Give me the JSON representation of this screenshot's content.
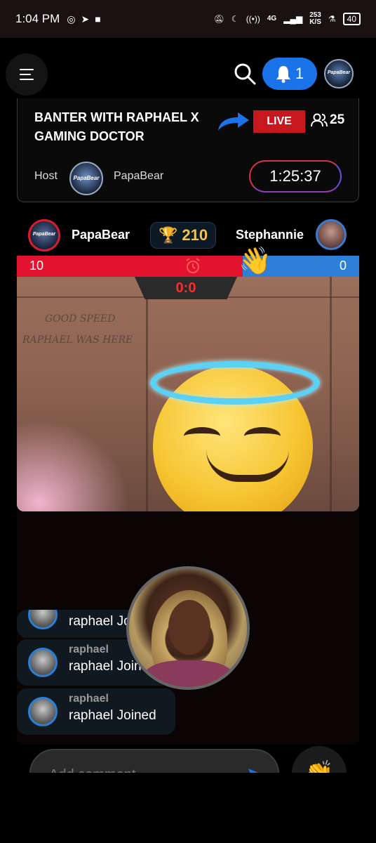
{
  "status_bar": {
    "time": "1:04 PM",
    "net_speed_value": "253",
    "net_speed_unit": "K/S",
    "network": "4G",
    "battery": "40"
  },
  "header": {
    "notification_count": "1",
    "avatar_text": "PapaBear"
  },
  "stream": {
    "title": "BANTER WITH RAPHAEL X GAMING DOCTOR",
    "live_label": "LIVE",
    "viewer_count": "25",
    "host_label": "Host",
    "host_avatar_text": "PapaBear",
    "host_name": "PapaBear",
    "timer": "1:25:37"
  },
  "battle": {
    "player1_name": "PapaBear",
    "player1_avatar_text": "PapaBear",
    "trophy_points": "210",
    "player2_name": "Stephannie",
    "player1_score": "10",
    "player2_score": "0",
    "player1_share": 0.66,
    "round_score": "0:0"
  },
  "video_scribbles": [
    "GOOD SPEED",
    "RAPHAEL WAS HERE"
  ],
  "chat": [
    {
      "user": "",
      "message": "raphael Joined"
    },
    {
      "user": "raphael",
      "message": "raphael Joined"
    },
    {
      "user": "raphael",
      "message": "raphael Joined"
    }
  ],
  "comment": {
    "placeholder": "Add comment..."
  },
  "colors": {
    "accent_blue": "#1a73e8",
    "live_red": "#c8171e",
    "score_red": "#e3122f",
    "score_blue": "#2d7fd8",
    "trophy_gold": "#f5c542"
  }
}
